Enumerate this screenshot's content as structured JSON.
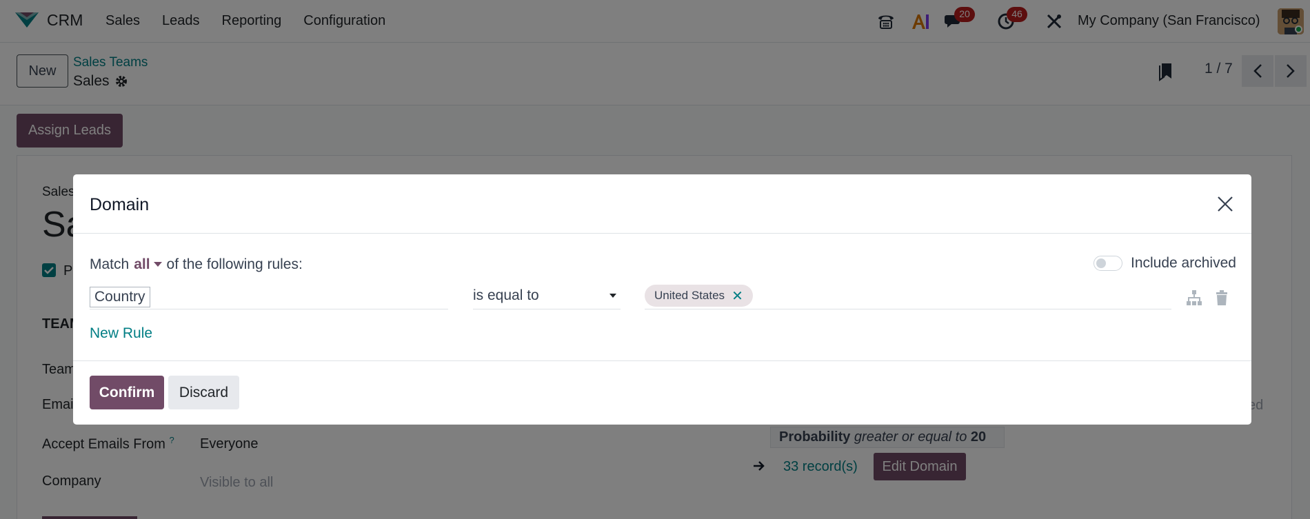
{
  "navbar": {
    "app_name": "CRM",
    "menu": [
      "Sales",
      "Leads",
      "Reporting",
      "Configuration"
    ],
    "chat_count": "20",
    "activity_count": "46",
    "company": "My Company (San Francisco)",
    "accent": "#714b67",
    "link_color": "#017e84"
  },
  "control_panel": {
    "new_label": "New",
    "breadcrumb_parent": "Sales Teams",
    "breadcrumb_current": "Sales",
    "pager": "1 / 7"
  },
  "form": {
    "assign_label": "Assign Leads",
    "sales_team_label": "Sales",
    "name_fragment": "Sa",
    "pipeline_fragment": "P",
    "team_heading_fragment": "TEAM",
    "team_leader_fragment": "Team",
    "email_fragment": "Emai",
    "accept_emails_label": "Accept Emails From",
    "accept_emails_help": "?",
    "accept_emails_value": "Everyone",
    "company_label": "Company",
    "company_value": "Visible to all",
    "right_fragment": "ed",
    "probability_label": "Probability",
    "probability_op": "greater or equal to",
    "probability_value": "20",
    "records_link": "33 record(s)",
    "edit_domain_label": "Edit Domain"
  },
  "modal": {
    "title": "Domain",
    "match_prefix": "Match",
    "match_value": "all",
    "match_suffix": "of the following rules:",
    "include_archived_label": "Include archived",
    "include_archived_on": false,
    "rules": [
      {
        "field": "Country",
        "operator": "is equal to",
        "value_tag": "United States"
      }
    ],
    "new_rule_label": "New Rule",
    "confirm_label": "Confirm",
    "discard_label": "Discard"
  }
}
